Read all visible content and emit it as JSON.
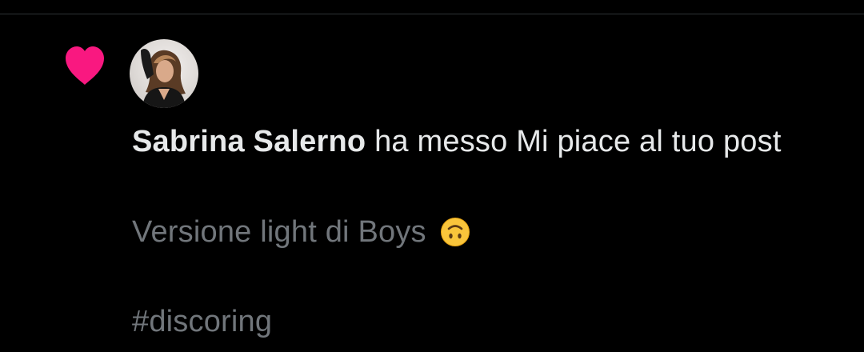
{
  "notification": {
    "type_icon": "heart-icon",
    "accent_color": "#f91880",
    "avatar_icon": "avatar",
    "user_name": "Sabrina Salerno",
    "action_text": " ha messo Mi piace al tuo post"
  },
  "post": {
    "line1": "Versione light di Boys",
    "emoji_icon": "upside-down-face-emoji",
    "line2": "#discoring"
  },
  "colors": {
    "background": "#000000",
    "primary_text": "#e7e9ea",
    "secondary_text": "#71767b",
    "divider": "#2f3336"
  }
}
